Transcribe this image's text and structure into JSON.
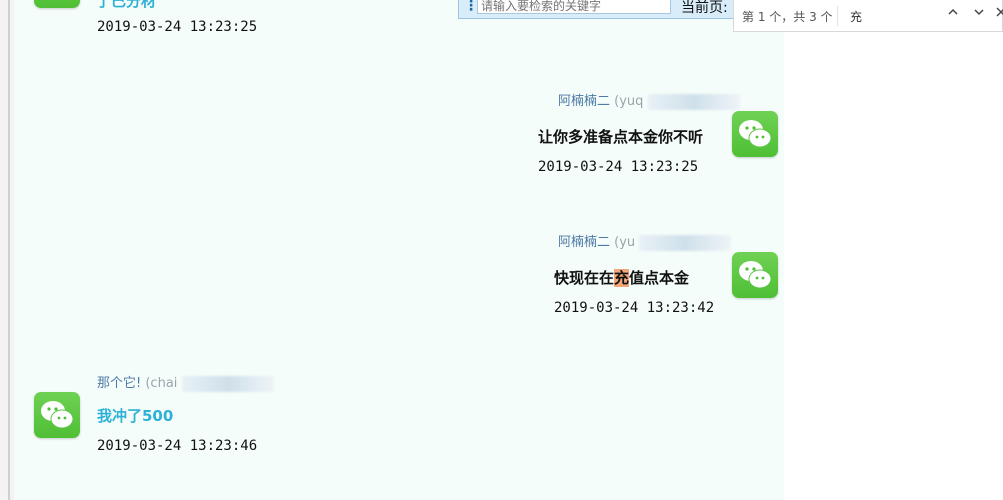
{
  "toolbar": {
    "search_placeholder": "请输入要检索的关键字",
    "page_label": "当前页:"
  },
  "find_bar": {
    "match_count": "第 1 个，共 3 个",
    "query": "充",
    "prev_icon": "chevron-up-icon",
    "next_icon": "chevron-down-icon",
    "close_icon": "close-icon"
  },
  "messages": [
    {
      "side": "left",
      "text": "了已分材",
      "time": "2019-03-24 13:23:25"
    },
    {
      "side": "right",
      "sender": "阿楠楠二",
      "sender_id": "(yuq",
      "text": "让你多准备点本金你不听",
      "time": "2019-03-24 13:23:25"
    },
    {
      "side": "right",
      "sender": "阿楠楠二",
      "sender_id": "(yu",
      "text_before": "快现在在",
      "text_highlight": "充",
      "text_after": "值点本金",
      "time": "2019-03-24 13:23:42"
    },
    {
      "side": "left",
      "sender": "那个它!",
      "sender_id": "(chai",
      "text": "我冲了500",
      "time": "2019-03-24 13:23:46"
    }
  ],
  "colors": {
    "chat_bg": "#f5fdfa",
    "highlight": "#f3a67a",
    "link_blue": "#2db0d6",
    "avatar_green": "#4fbf35"
  }
}
